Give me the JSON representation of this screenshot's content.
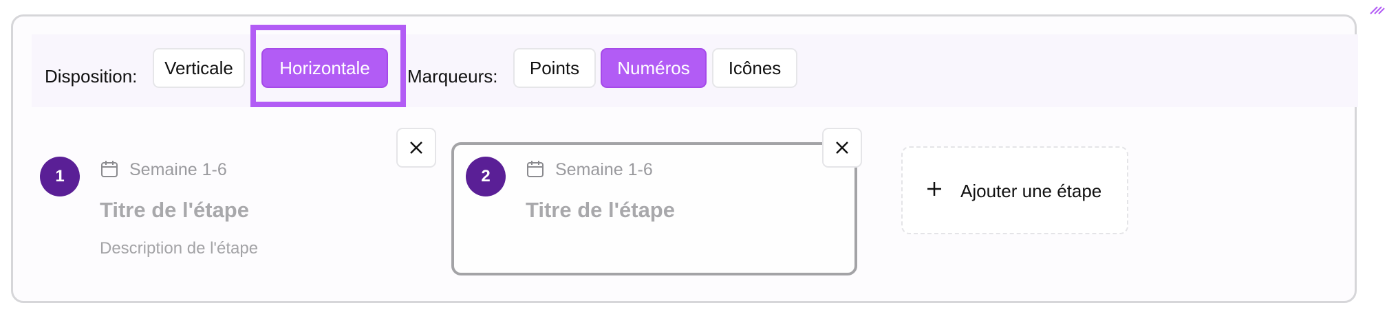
{
  "toolbar": {
    "layout_label": "Disposition:",
    "layout_options": [
      "Verticale",
      "Horizontale"
    ],
    "layout_selected": "Horizontale",
    "marker_label": "Marqueurs:",
    "marker_options": [
      "Points",
      "Numéros",
      "Icônes"
    ],
    "marker_selected": "Numéros"
  },
  "steps": [
    {
      "number": "1",
      "date": "Semaine 1-6",
      "title": "Titre de l'étape",
      "description": "Description de l'étape",
      "date_icon": "calendar-icon"
    },
    {
      "number": "2",
      "date": "Semaine 1-6",
      "title": "Titre de l'étape",
      "date_icon": "calendar-icon"
    }
  ],
  "add_step": {
    "label": "Ajouter une étape",
    "icon": "plus-icon"
  },
  "colors": {
    "accent": "#b25cf5",
    "marker": "#5a1f96",
    "placeholder_text": "#a8a8ab",
    "border": "#d6d6d9"
  }
}
